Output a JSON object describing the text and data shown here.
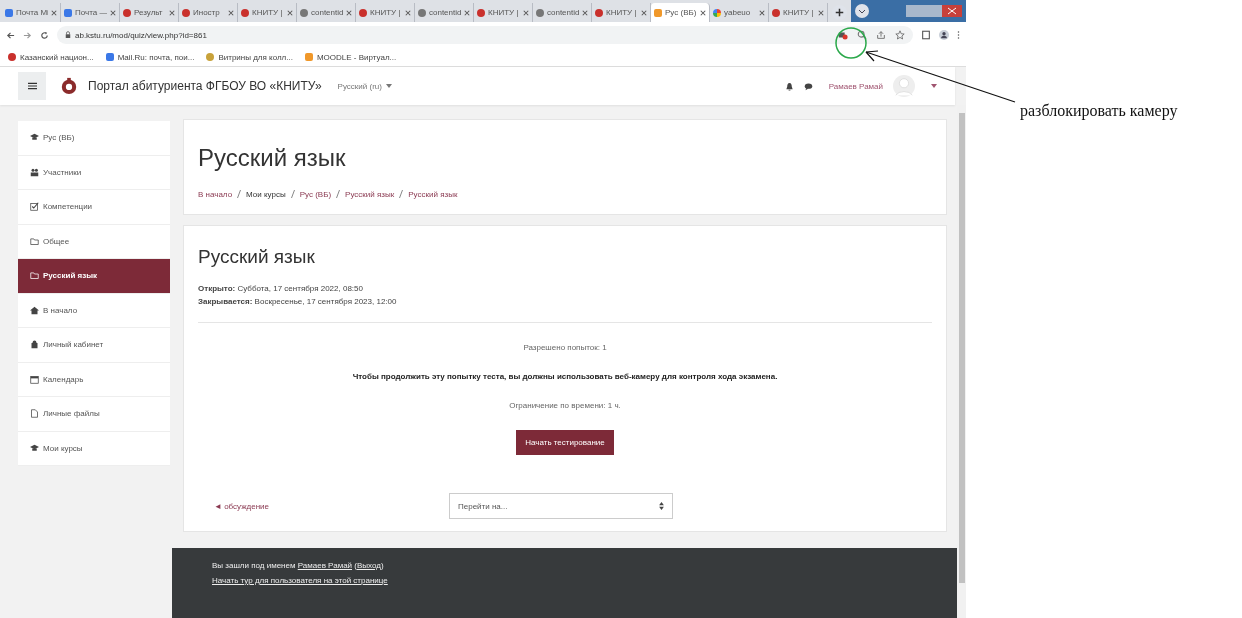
{
  "browser": {
    "tabs": [
      {
        "label": "Почта Mi",
        "kind": "mail",
        "selected": false
      },
      {
        "label": "Почта —",
        "kind": "doc",
        "selected": false
      },
      {
        "label": "Результ",
        "kind": "logo",
        "selected": false
      },
      {
        "label": "Иностр",
        "kind": "logo",
        "selected": false
      },
      {
        "label": "КНИТУ |",
        "kind": "logo",
        "selected": false
      },
      {
        "label": "contentid",
        "kind": "globe",
        "selected": false
      },
      {
        "label": "КНИТУ |",
        "kind": "logo",
        "selected": false
      },
      {
        "label": "contentid",
        "kind": "globe",
        "selected": false
      },
      {
        "label": "КНИТУ |",
        "kind": "logo",
        "selected": false
      },
      {
        "label": "contentid",
        "kind": "globe",
        "selected": false
      },
      {
        "label": "КНИТУ |",
        "kind": "logo",
        "selected": false
      },
      {
        "label": "Рус (ВБ)",
        "kind": "moodle",
        "selected": true
      },
      {
        "label": "yabeuo",
        "kind": "google",
        "selected": false
      },
      {
        "label": "КНИТУ |",
        "kind": "logo",
        "selected": false
      }
    ],
    "url": "ab.kstu.ru/mod/quiz/view.php?id=861",
    "bookmarks": [
      {
        "label": "Казанский национ...",
        "kind": "logo"
      },
      {
        "label": "Mail.Ru: почта, пои...",
        "kind": "doc"
      },
      {
        "label": "Витрины для колл...",
        "kind": "badge"
      },
      {
        "label": "MOODLE - Виртуал...",
        "kind": "moodle"
      }
    ]
  },
  "navbar": {
    "site_name": "Портал абитуриента ФГБОУ ВО «КНИТУ»",
    "language": "Русский (ru)",
    "user": "Рамаев Рамай"
  },
  "sidebar": {
    "items": [
      {
        "label": "Рус (ВБ)",
        "kind": "cap",
        "selected": false
      },
      {
        "label": "Участники",
        "kind": "users",
        "selected": false
      },
      {
        "label": "Компетенции",
        "kind": "check",
        "selected": false
      },
      {
        "label": "Общее",
        "kind": "folder",
        "selected": false
      },
      {
        "label": "Русский язык",
        "kind": "folder",
        "selected": true
      },
      {
        "label": "В начало",
        "kind": "home",
        "selected": false
      },
      {
        "label": "Личный кабинет",
        "kind": "cab",
        "selected": false
      },
      {
        "label": "Календарь",
        "kind": "calendar",
        "selected": false
      },
      {
        "label": "Личные файлы",
        "kind": "file",
        "selected": false
      },
      {
        "label": "Мои курсы",
        "kind": "cap",
        "selected": false
      }
    ]
  },
  "header": {
    "title": "Русский язык",
    "breadcrumbs": [
      {
        "label": "В начало",
        "link": true
      },
      {
        "label": "Мои курсы",
        "link": false
      },
      {
        "label": "Рус (ВБ)",
        "link": true
      },
      {
        "label": "Русский язык",
        "link": true
      },
      {
        "label": "Русский язык",
        "link": true
      }
    ]
  },
  "quiz": {
    "title": "Русский язык",
    "dates": [
      {
        "label": "Открыто:",
        "value": "Суббота, 17 сентября 2022, 08:50"
      },
      {
        "label": "Закрывается:",
        "value": "Воскресенье, 17 сентября 2023, 12:00"
      }
    ],
    "attempts": "Разрешено попыток: 1",
    "webcam_notice": "Чтобы продолжить эту попытку теста, вы должны использовать веб-камеру для контроля хода экзамена.",
    "time_limit": "Ограничение по времени: 1 ч.",
    "start_button": "Начать тестирование",
    "prev_link": "◄ обсуждение",
    "jump_placeholder": "Перейти на..."
  },
  "footer": {
    "logged_in_prefix": "Вы зашли под именем",
    "user": "Рамаев Рамай",
    "logout_open": "(",
    "logout": "Выход",
    "logout_close": ")",
    "tour": "Начать тур для пользователя на этой странице"
  },
  "annotation": {
    "text": "разблокировать камеру"
  }
}
